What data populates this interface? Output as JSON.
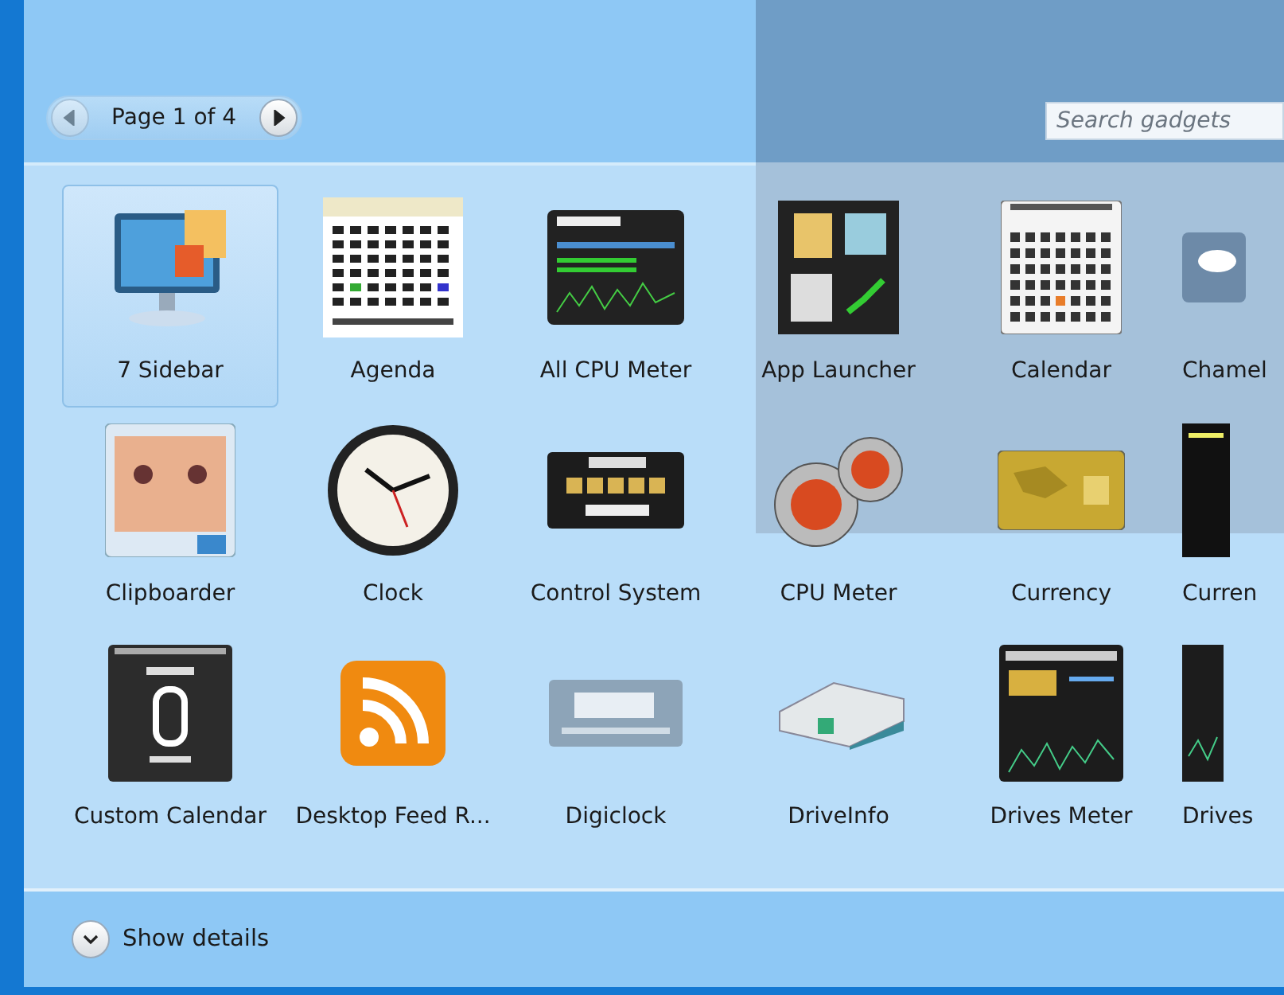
{
  "pager": {
    "label": "Page 1 of 4",
    "prev_disabled": true
  },
  "search": {
    "placeholder": "Search gadgets"
  },
  "gadgets": [
    {
      "name": "7 Sidebar",
      "selected": true
    },
    {
      "name": "Agenda",
      "selected": false
    },
    {
      "name": "All CPU Meter",
      "selected": false
    },
    {
      "name": "App Launcher",
      "selected": false
    },
    {
      "name": "Calendar",
      "selected": false
    },
    {
      "name": "Chamel",
      "selected": false
    },
    {
      "name": "Clipboarder",
      "selected": false
    },
    {
      "name": "Clock",
      "selected": false
    },
    {
      "name": "Control System",
      "selected": false
    },
    {
      "name": "CPU Meter",
      "selected": false
    },
    {
      "name": "Currency",
      "selected": false
    },
    {
      "name": "Curren",
      "selected": false
    },
    {
      "name": "Custom Calendar",
      "selected": false
    },
    {
      "name": "Desktop Feed R...",
      "selected": false
    },
    {
      "name": "Digiclock",
      "selected": false
    },
    {
      "name": "DriveInfo",
      "selected": false
    },
    {
      "name": "Drives Meter",
      "selected": false
    },
    {
      "name": "Drives",
      "selected": false
    }
  ],
  "details": {
    "label": "Show details",
    "expanded": false
  }
}
